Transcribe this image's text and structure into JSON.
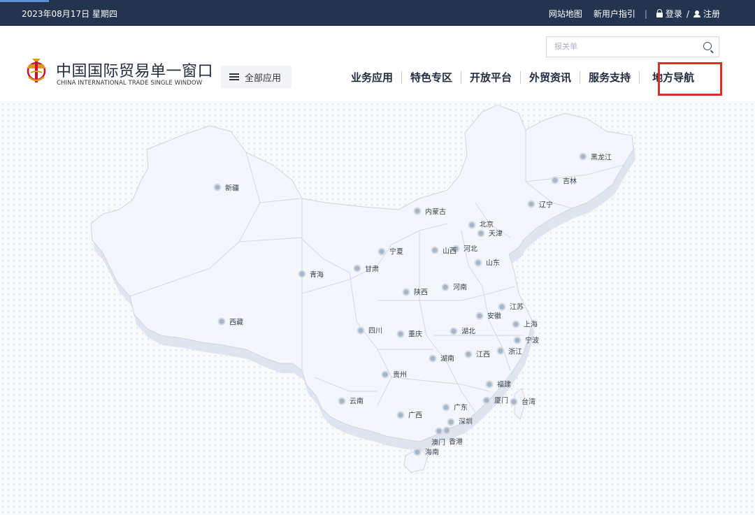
{
  "topbar": {
    "date": "2023年08月17日 星期四",
    "site_map": "网站地图",
    "new_user_guide": "新用户指引",
    "divider": "|",
    "login": "登录",
    "slash": "/",
    "register": "注册"
  },
  "header": {
    "logo_cn": "中国国际贸易单一窗口",
    "logo_en": "CHINA INTERNATIONAL TRADE SINGLE WINDOW",
    "all_apps": "全部应用",
    "search_placeholder": "报关单"
  },
  "nav": [
    "业务应用",
    "特色专区",
    "开放平台",
    "外贸资讯",
    "服务支持",
    "地方导航"
  ],
  "colors": {
    "topbar": "#24344f",
    "highlight": "#d9302a",
    "map_fill": "#f3f6fa",
    "pin": "#a9b5c6"
  },
  "regions": [
    "黑龙江",
    "吉林",
    "辽宁",
    "新疆",
    "内蒙古",
    "北京",
    "天津",
    "河北",
    "宁夏",
    "山西",
    "甘肃",
    "青海",
    "山东",
    "陕西",
    "河南",
    "江苏",
    "西藏",
    "安徽",
    "上海",
    "四川",
    "重庆",
    "湖北",
    "宁波",
    "浙江",
    "湖南",
    "江西",
    "贵州",
    "福建",
    "云南",
    "广东",
    "厦门",
    "台湾",
    "广西",
    "深圳",
    "澳门",
    "香港",
    "海南"
  ]
}
